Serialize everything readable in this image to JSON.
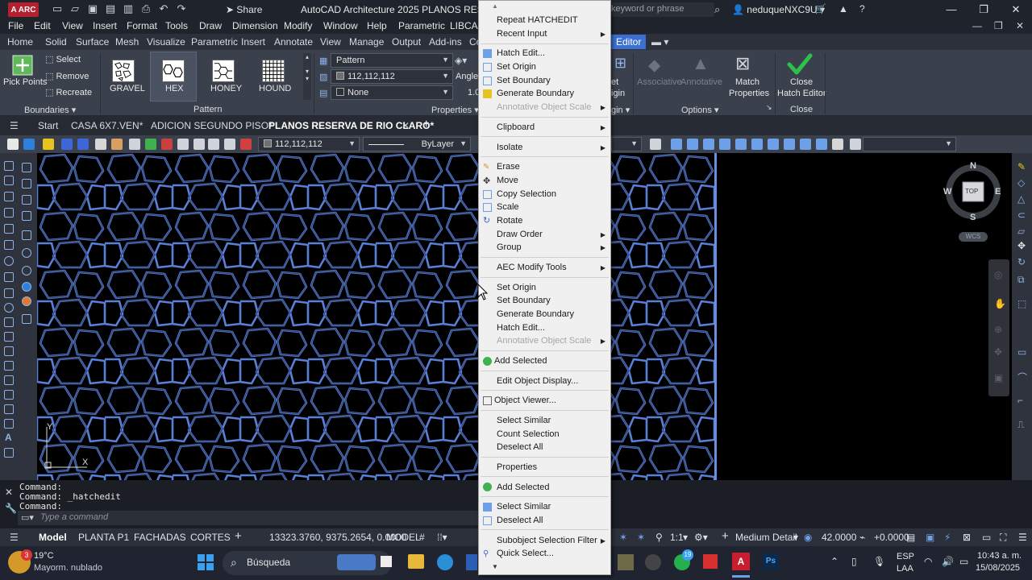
{
  "titlebar": {
    "app_badge": "A ARC",
    "share": "Share",
    "title": "AutoCAD Architecture 2025    PLANOS RESERVA D",
    "search_placeholder": "keyword or phrase",
    "user": "neduqueNXC9U"
  },
  "menubar": [
    "File",
    "Edit",
    "View",
    "Insert",
    "Format",
    "Tools",
    "Draw",
    "Dimension",
    "Modify",
    "Window",
    "Help",
    "Parametric",
    "LIBCAD"
  ],
  "ribbon_tabs": [
    "Home",
    "Solid",
    "Surface",
    "Mesh",
    "Visualize",
    "Parametric",
    "Insert",
    "Annotate",
    "View",
    "Manage",
    "Output",
    "Add-ins",
    "Co"
  ],
  "ribbon_tab_active": "Editor",
  "ribbon": {
    "pick_points": "Pick Points",
    "select": "Select",
    "remove": "Remove",
    "recreate": "Recreate",
    "boundaries": "Boundaries",
    "patterns": [
      "GRAVEL",
      "HEX",
      "HONEY",
      "HOUND"
    ],
    "pattern_panel": "Pattern",
    "pattern_type": "Pattern",
    "hatch_color": "112,112,112",
    "background_color": "None",
    "angle_label": "Angle",
    "scale_value": "1.0",
    "properties_panel": "Properties",
    "set_origin_partial": "et",
    "origin_partial": "igin",
    "origin_panel_partial": "gin",
    "associative": "Associative",
    "annotative": "Annotative",
    "match_properties_1": "Match",
    "match_properties_2": "Properties",
    "options_panel": "Options",
    "close_1": "Close",
    "close_2": "Hatch Editor",
    "close_panel": "Close"
  },
  "doc_tabs": [
    "Start",
    "CASA 6X7.VEN*",
    "ADICION SEGUNDO PISO*",
    "PLANOS RESERVA DE RIO CLARO*"
  ],
  "toolbar": {
    "color_value": "112,112,112",
    "linetype_value": "ByLayer"
  },
  "viewcube": {
    "n": "N",
    "s": "S",
    "e": "E",
    "w": "W",
    "top": "TOP",
    "wcs": "WCS"
  },
  "ucs": {
    "y": "Y",
    "x": "X"
  },
  "command": {
    "lines": [
      "Command:",
      "Command:  _hatchedit",
      "Command:"
    ],
    "placeholder": "Type a command"
  },
  "statusbar": {
    "model_tab": "Model",
    "layouts": [
      "PLANTA P1",
      "FACHADAS",
      "CORTES"
    ],
    "coords": "13323.3760, 9375.2654, 0.0000",
    "space": "MODEL",
    "scale": "1:1",
    "detail": "Medium Detail",
    "elevation": "42.0000",
    "offset": "+0.0000"
  },
  "taskbar": {
    "weather_temp": "19°C",
    "weather_desc": "Mayorm. nublado",
    "weather_badge": "3",
    "search": "Búsqueda",
    "lang_1": "ESP",
    "lang_2": "LAA",
    "time": "10:43 a. m.",
    "date": "15/08/2025",
    "whatsapp_badge": "19"
  },
  "context_menu": {
    "items": [
      {
        "label": "Repeat HATCHEDIT",
        "disabled": false,
        "submenu": false
      },
      {
        "label": "Recent Input",
        "disabled": false,
        "submenu": true
      },
      {
        "label": "Hatch Edit...",
        "disabled": false,
        "submenu": false
      },
      {
        "label": "Set Origin",
        "disabled": false,
        "submenu": false
      },
      {
        "label": "Set Boundary",
        "disabled": false,
        "submenu": false
      },
      {
        "label": "Generate Boundary",
        "disabled": false,
        "submenu": false
      },
      {
        "label": "Annotative Object Scale",
        "disabled": true,
        "submenu": true
      },
      {
        "label": "Clipboard",
        "disabled": false,
        "submenu": true
      },
      {
        "label": "Isolate",
        "disabled": false,
        "submenu": true
      },
      {
        "label": "Erase",
        "disabled": false,
        "submenu": false
      },
      {
        "label": "Move",
        "disabled": false,
        "submenu": false
      },
      {
        "label": "Copy Selection",
        "disabled": false,
        "submenu": false
      },
      {
        "label": "Scale",
        "disabled": false,
        "submenu": false
      },
      {
        "label": "Rotate",
        "disabled": false,
        "submenu": false
      },
      {
        "label": "Draw Order",
        "disabled": false,
        "submenu": true
      },
      {
        "label": "Group",
        "disabled": false,
        "submenu": true
      },
      {
        "label": "AEC Modify Tools",
        "disabled": false,
        "submenu": true
      },
      {
        "label": "Set Origin",
        "disabled": false,
        "submenu": false
      },
      {
        "label": "Set Boundary",
        "disabled": false,
        "submenu": false
      },
      {
        "label": "Generate Boundary",
        "disabled": false,
        "submenu": false
      },
      {
        "label": "Hatch Edit...",
        "disabled": false,
        "submenu": false
      },
      {
        "label": "Annotative Object Scale",
        "disabled": true,
        "submenu": true
      },
      {
        "label": "Add Selected",
        "disabled": false,
        "submenu": false
      },
      {
        "label": "Edit Object Display...",
        "disabled": false,
        "submenu": false
      },
      {
        "label": "Object Viewer...",
        "disabled": false,
        "submenu": false
      },
      {
        "label": "Select Similar",
        "disabled": false,
        "submenu": false
      },
      {
        "label": "Count Selection",
        "disabled": false,
        "submenu": false
      },
      {
        "label": "Deselect All",
        "disabled": false,
        "submenu": false
      },
      {
        "label": "Properties",
        "disabled": false,
        "submenu": false
      },
      {
        "label": "Add Selected",
        "disabled": false,
        "submenu": false
      },
      {
        "label": "Select Similar",
        "disabled": false,
        "submenu": false
      },
      {
        "label": "Deselect All",
        "disabled": false,
        "submenu": false
      },
      {
        "label": "Subobject Selection Filter",
        "disabled": false,
        "submenu": true
      },
      {
        "label": "Quick Select...",
        "disabled": false,
        "submenu": false
      }
    ]
  },
  "colors": {
    "hatch_line": "#5a7fd6",
    "accent": "#3b6fd1",
    "close_check": "#2bc24a"
  }
}
